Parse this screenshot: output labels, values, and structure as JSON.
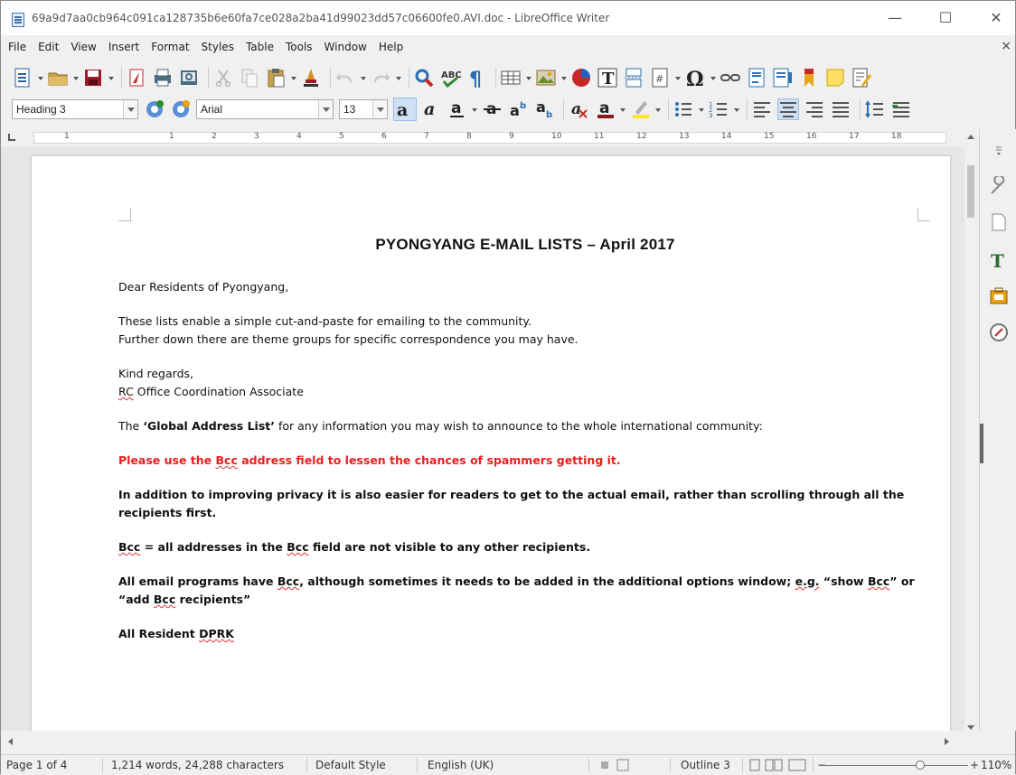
{
  "window": {
    "title": "69a9d7aa0cb964c091ca128735b6e60fa7ce028a2ba41d99023dd57c06600fe0.AVI.doc - LibreOffice Writer",
    "minimize": "—",
    "maximize": "☐",
    "close": "✕"
  },
  "menu": {
    "items": [
      "File",
      "Edit",
      "View",
      "Insert",
      "Format",
      "Styles",
      "Table",
      "Tools",
      "Window",
      "Help"
    ],
    "close": "×"
  },
  "formatting": {
    "paragraph_style": "Heading 3",
    "font_name": "Arial",
    "font_size": "13"
  },
  "ruler": {
    "labels": [
      "1",
      "1",
      "2",
      "3",
      "4",
      "5",
      "6",
      "7",
      "8",
      "9",
      "10",
      "11",
      "12",
      "13",
      "14",
      "15",
      "16",
      "17",
      "18"
    ]
  },
  "document": {
    "heading": "PYONGYANG E-MAIL LISTS – April 2017",
    "greeting": "Dear Residents of Pyongyang,",
    "intro_line1": "These lists enable a simple cut-and-paste for emailing to the community.",
    "intro_line2": "Further down there are theme groups for specific correspondence you may have.",
    "regards": "Kind regards,",
    "signature_rc": "RC",
    "signature_rest": " Office Coordination Associate",
    "gal_pre": "The ",
    "gal_bold": "‘Global Address List’",
    "gal_post": " for any information you may wish to announce to the whole international community:",
    "warning_pre": "Please use the ",
    "warning_bcc": "Bcc",
    "warning_post": " address field to lessen the chances of spammers getting it.",
    "privacy": "In addition to improving privacy it is also easier for readers to get to the actual email, rather than scrolling through all the recipients first.",
    "bcc_def_a": "Bcc",
    "bcc_def_b": " = all addresses in the ",
    "bcc_def_c": "Bcc",
    "bcc_def_d": " field are not visible to any other recipients.",
    "programs_a": "All email programs have ",
    "programs_b": "Bcc",
    "programs_c": ", although sometimes it needs to be added in the additional options window; ",
    "programs_d": "e.g.",
    "programs_e": " “show ",
    "programs_f": "Bcc",
    "programs_g": "” or “add ",
    "programs_h": "Bcc",
    "programs_i": " recipients”",
    "all_resident_a": "All Resident ",
    "all_resident_b": "DPRK"
  },
  "status": {
    "page": "Page 1 of 4",
    "words": "1,214 words, 24,288 characters",
    "style": "Default Style",
    "language": "English (UK)",
    "outline": "Outline 3",
    "zoom": "110%",
    "zoom_minus": "−",
    "zoom_plus": "+"
  },
  "colors": {
    "warning_red": "#e8201f",
    "accent_blue": "#cfe0f4"
  }
}
